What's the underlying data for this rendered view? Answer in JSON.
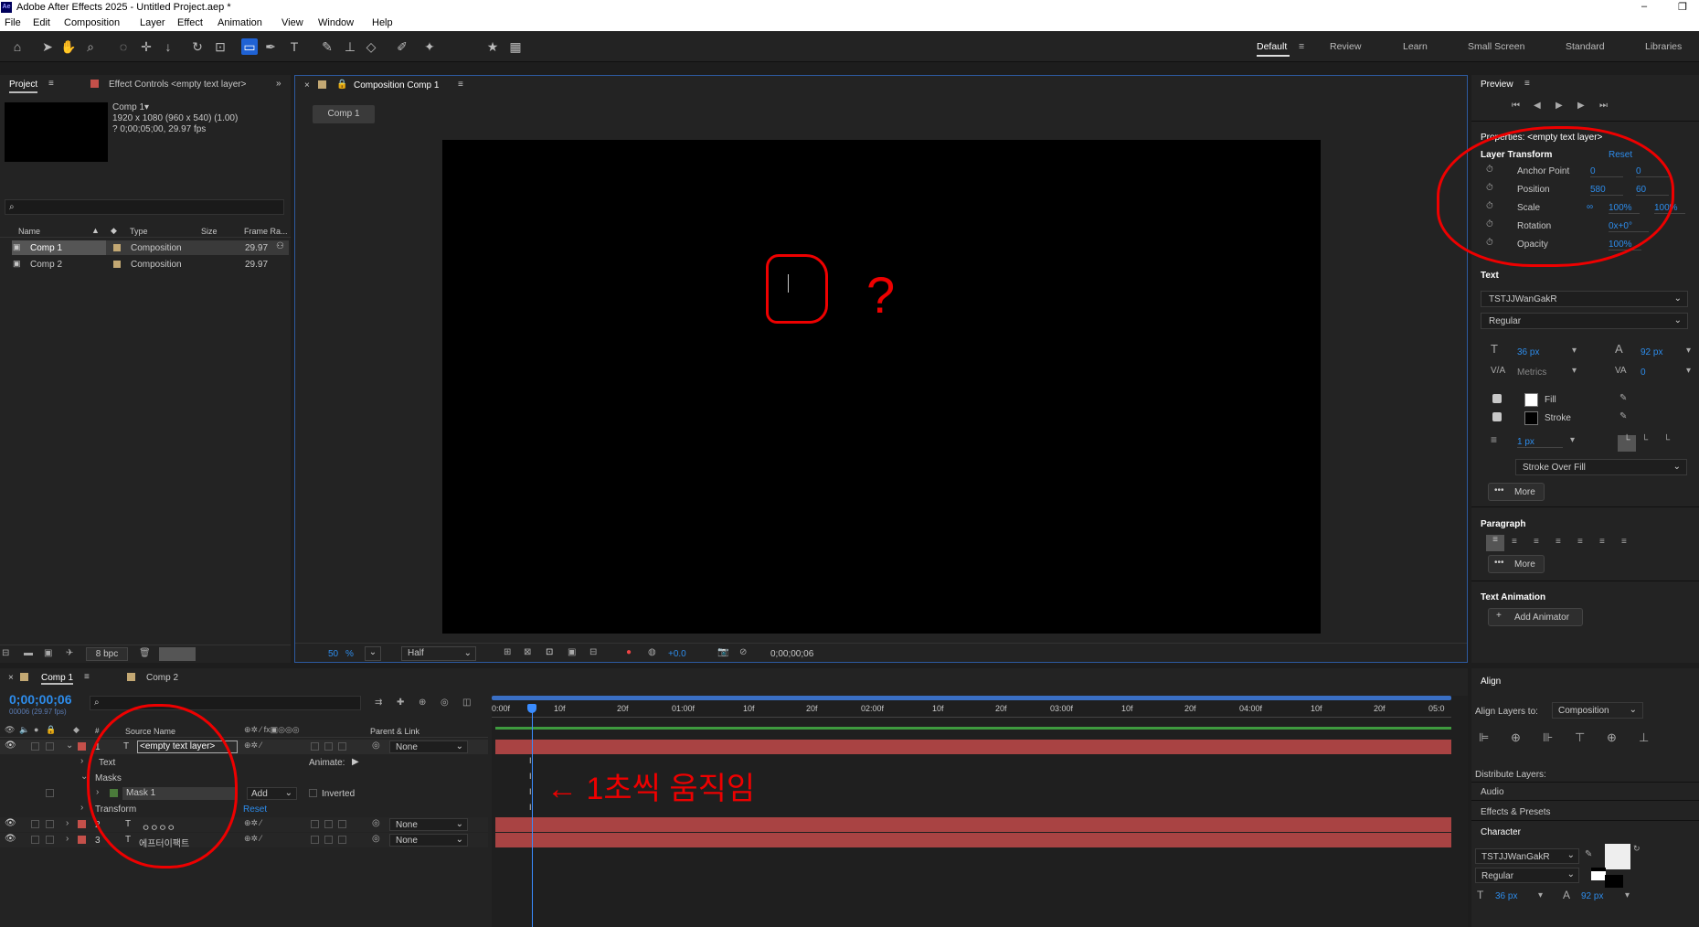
{
  "window": {
    "logo": "Ae",
    "title": "Adobe After Effects 2025 - Untitled Project.aep *",
    "min": "–",
    "max": "❐"
  },
  "menu": [
    "File",
    "Edit",
    "Composition",
    "Layer",
    "Effect",
    "Animation",
    "View",
    "Window",
    "Help"
  ],
  "workspaces": [
    "Default",
    "Review",
    "Learn",
    "Small Screen",
    "Standard",
    "Libraries"
  ],
  "project": {
    "tab": "Project",
    "effect_tab": "Effect Controls <empty text layer>",
    "comp_name": "Comp 1▾",
    "comp_info1": "1920 x 1080  (960 x 540) (1.00)",
    "comp_info2": "? 0;00;05;00, 29.97 fps",
    "search_placeholder": "",
    "cols": [
      "Name",
      "Type",
      "Size",
      "Frame Ra..."
    ],
    "rows": [
      {
        "name": "Comp 1",
        "type": "Composition",
        "fps": "29.97"
      },
      {
        "name": "Comp 2",
        "type": "Composition",
        "fps": "29.97"
      }
    ],
    "bpc": "8 bpc"
  },
  "comp": {
    "tab": "Composition Comp 1",
    "crumb": "Comp 1",
    "zoom": "50",
    "zoom_unit": "%",
    "res": "Half",
    "exposure": "+0.0",
    "time": "0;00;00;06"
  },
  "preview": {
    "title": "Preview"
  },
  "properties": {
    "title": "Properties: <empty text layer>",
    "layer_transform": "Layer Transform",
    "reset": "Reset",
    "rows": [
      {
        "label": "Anchor Point",
        "v1": "0",
        "v2": "0"
      },
      {
        "label": "Position",
        "v1": "580",
        "v2": "60"
      },
      {
        "label": "Scale",
        "v1": "100%",
        "v2": "100%"
      },
      {
        "label": "Rotation",
        "v1": "0x+0°",
        "v2": ""
      },
      {
        "label": "Opacity",
        "v1": "100%",
        "v2": ""
      }
    ],
    "text_title": "Text",
    "font": "TSTJJWanGakR",
    "style": "Regular",
    "size": "36 px",
    "leading": "92 px",
    "kerning": "Metrics",
    "tracking": "0",
    "fill": "Fill",
    "stroke": "Stroke",
    "stroke_w": "1 px",
    "stroke_mode": "Stroke Over Fill",
    "more": "More",
    "paragraph": "Paragraph",
    "more2": "More",
    "text_anim": "Text Animation",
    "add_animator": "Add Animator"
  },
  "align": {
    "title": "Align",
    "align_to_label": "Align Layers to:",
    "align_to": "Composition",
    "distribute": "Distribute Layers:",
    "audio": "Audio",
    "effects": "Effects & Presets",
    "character": "Character",
    "font": "TSTJJWanGakR",
    "style": "Regular",
    "size": "36 px",
    "leading": "92 px"
  },
  "timeline": {
    "tab1": "Comp 1",
    "tab2": "Comp 2",
    "timecode": "0;00;00;06",
    "fps": "00006 (29.97 fps)",
    "source_name": "Source Name",
    "parent": "Parent & Link",
    "layers": [
      {
        "num": "1",
        "name": "<empty text layer>",
        "parent": "None"
      },
      {
        "num": "2",
        "name": "ㅇㅇㅇㅇ",
        "parent": "None"
      },
      {
        "num": "3",
        "name": "에프터이팩트",
        "parent": "None"
      }
    ],
    "text": "Text",
    "animate": "Animate:",
    "masks": "Masks",
    "mask1": "Mask 1",
    "add": "Add",
    "inverted": "Inverted",
    "transform": "Transform",
    "reset": "Reset",
    "ruler": [
      "0:00f",
      "10f",
      "20f",
      "01:00f",
      "10f",
      "20f",
      "02:00f",
      "10f",
      "20f",
      "03:00f",
      "10f",
      "20f",
      "04:00f",
      "10f",
      "20f",
      "05:0"
    ]
  },
  "annotation": {
    "question": "?",
    "note": "← 1초씩 움직임"
  }
}
